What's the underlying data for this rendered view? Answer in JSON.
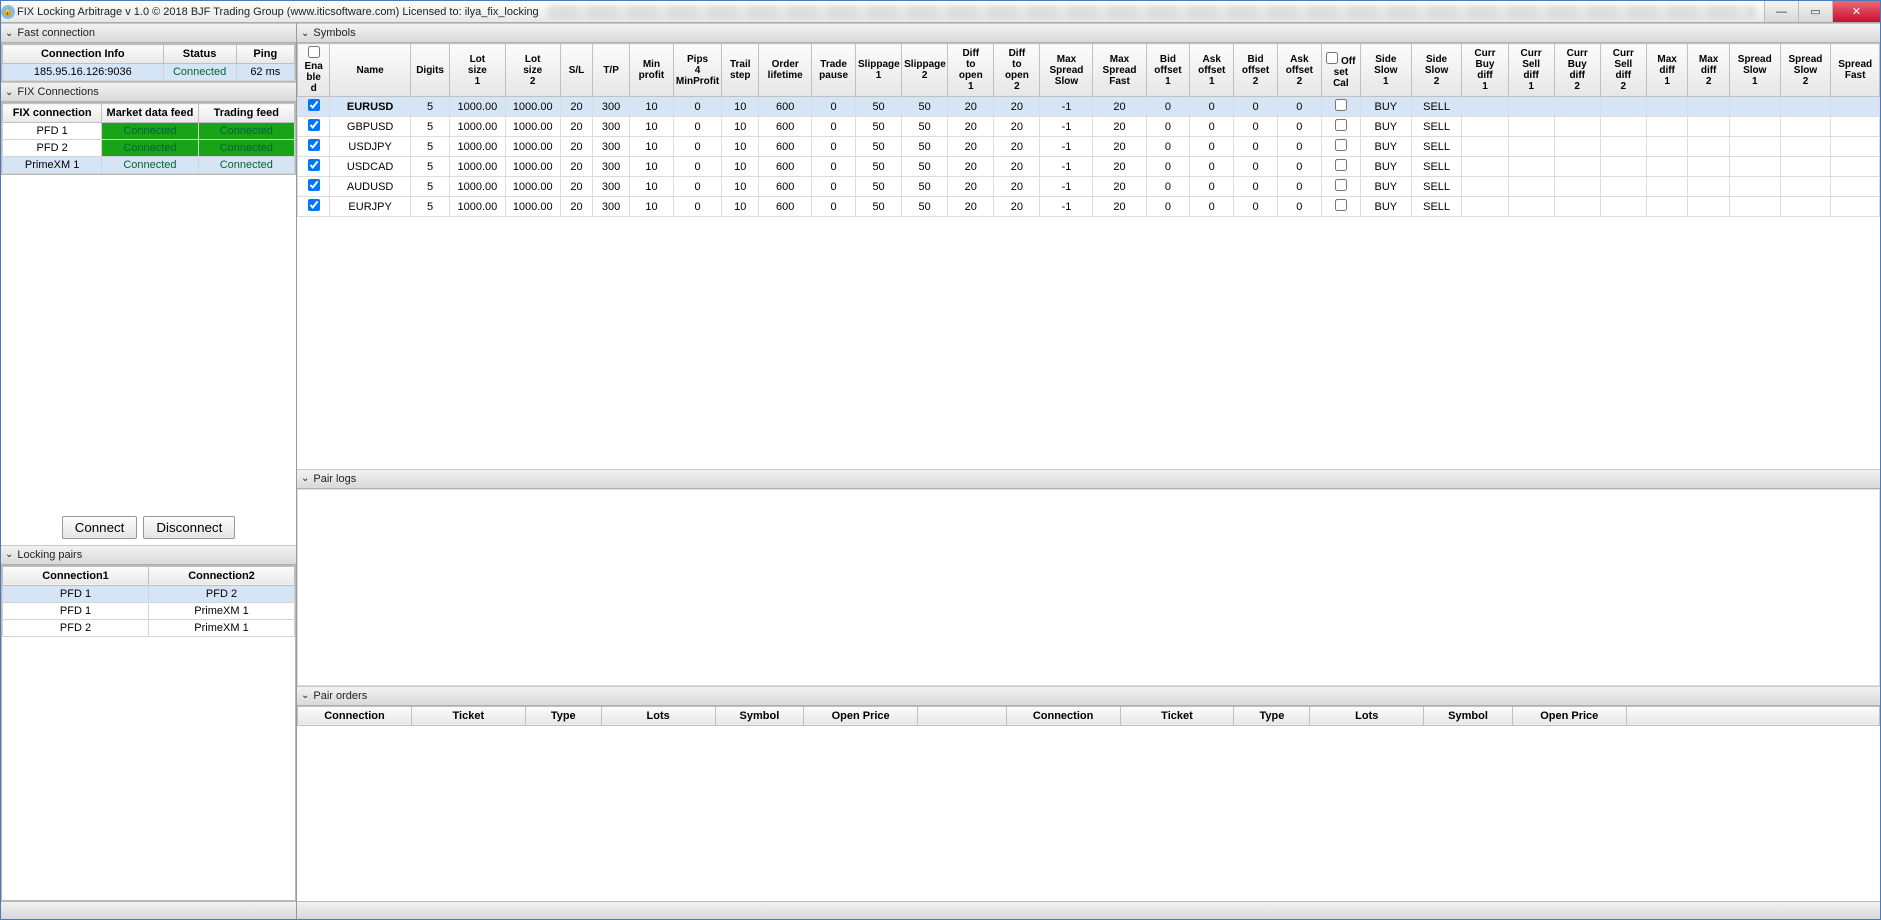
{
  "window": {
    "title": "FIX Locking Arbitrage v 1.0 © 2018 BJF Trading Group (www.iticsoftware.com) Licensed to: ilya_fix_locking"
  },
  "left": {
    "fast_connection_label": "Fast connection",
    "conn_info_headers": [
      "Connection Info",
      "Status",
      "Ping"
    ],
    "conn_info_row": {
      "addr": "185.95.16.126:9036",
      "status": "Connected",
      "ping": "62 ms"
    },
    "fix_connections_label": "FIX Connections",
    "fix_headers": [
      "FIX connection",
      "Market data feed",
      "Trading feed"
    ],
    "fix_rows": [
      {
        "name": "PFD 1",
        "market": "Connected",
        "trade": "Connected",
        "sel": false
      },
      {
        "name": "PFD 2",
        "market": "Connected",
        "trade": "Connected",
        "sel": false
      },
      {
        "name": "PrimeXM 1",
        "market": "Connected",
        "trade": "Connected",
        "sel": true
      }
    ],
    "connect_label": "Connect",
    "disconnect_label": "Disconnect",
    "locking_pairs_label": "Locking pairs",
    "lock_headers": [
      "Connection1",
      "Connection2"
    ],
    "lock_rows": [
      {
        "c1": "PFD 1",
        "c2": "PFD 2",
        "sel": true
      },
      {
        "c1": "PFD 1",
        "c2": "PrimeXM 1",
        "sel": false
      },
      {
        "c1": "PFD 2",
        "c2": "PrimeXM 1",
        "sel": false
      }
    ]
  },
  "symbols": {
    "label": "Symbols",
    "headers": [
      "Enabled",
      "Name",
      "Digits",
      "Lot size 1",
      "Lot size 2",
      "S/L",
      "T/P",
      "Min profit",
      "Pips 4 MinProfit",
      "Trail step",
      "Order lifetime",
      "Trade pause",
      "Slippage 1",
      "Slippage 2",
      "Diff to open 1",
      "Diff to open 2",
      "Max Spread Slow",
      "Max Spread Fast",
      "Bid offset 1",
      "Ask offset 1",
      "Bid offset 2",
      "Ask offset 2",
      "Offset Cal",
      "Side Slow 1",
      "Side Slow 2",
      "Curr Buy diff 1",
      "Curr Sell diff 1",
      "Curr Buy diff 2",
      "Curr Sell diff 2",
      "Max diff 1",
      "Max diff 2",
      "Spread Slow 1",
      "Spread Slow 2",
      "Spread Fast"
    ],
    "rows": [
      {
        "enabled": true,
        "sel": true,
        "name": "EURUSD",
        "digits": "5",
        "lot1": "1000.00",
        "lot2": "1000.00",
        "sl": "20",
        "tp": "300",
        "minp": "10",
        "p4mp": "0",
        "trail": "10",
        "life": "600",
        "pause": "0",
        "sl1": "50",
        "sl2": "50",
        "d1": "20",
        "d2": "20",
        "mss": "-1",
        "msf": "20",
        "bo1": "0",
        "ao1": "0",
        "bo2": "0",
        "ao2": "0",
        "oc": false,
        "side1": "BUY",
        "side2": "SELL"
      },
      {
        "enabled": true,
        "sel": false,
        "name": "GBPUSD",
        "digits": "5",
        "lot1": "1000.00",
        "lot2": "1000.00",
        "sl": "20",
        "tp": "300",
        "minp": "10",
        "p4mp": "0",
        "trail": "10",
        "life": "600",
        "pause": "0",
        "sl1": "50",
        "sl2": "50",
        "d1": "20",
        "d2": "20",
        "mss": "-1",
        "msf": "20",
        "bo1": "0",
        "ao1": "0",
        "bo2": "0",
        "ao2": "0",
        "oc": false,
        "side1": "BUY",
        "side2": "SELL"
      },
      {
        "enabled": true,
        "sel": false,
        "name": "USDJPY",
        "digits": "5",
        "lot1": "1000.00",
        "lot2": "1000.00",
        "sl": "20",
        "tp": "300",
        "minp": "10",
        "p4mp": "0",
        "trail": "10",
        "life": "600",
        "pause": "0",
        "sl1": "50",
        "sl2": "50",
        "d1": "20",
        "d2": "20",
        "mss": "-1",
        "msf": "20",
        "bo1": "0",
        "ao1": "0",
        "bo2": "0",
        "ao2": "0",
        "oc": false,
        "side1": "BUY",
        "side2": "SELL"
      },
      {
        "enabled": true,
        "sel": false,
        "name": "USDCAD",
        "digits": "5",
        "lot1": "1000.00",
        "lot2": "1000.00",
        "sl": "20",
        "tp": "300",
        "minp": "10",
        "p4mp": "0",
        "trail": "10",
        "life": "600",
        "pause": "0",
        "sl1": "50",
        "sl2": "50",
        "d1": "20",
        "d2": "20",
        "mss": "-1",
        "msf": "20",
        "bo1": "0",
        "ao1": "0",
        "bo2": "0",
        "ao2": "0",
        "oc": false,
        "side1": "BUY",
        "side2": "SELL"
      },
      {
        "enabled": true,
        "sel": false,
        "name": "AUDUSD",
        "digits": "5",
        "lot1": "1000.00",
        "lot2": "1000.00",
        "sl": "20",
        "tp": "300",
        "minp": "10",
        "p4mp": "0",
        "trail": "10",
        "life": "600",
        "pause": "0",
        "sl1": "50",
        "sl2": "50",
        "d1": "20",
        "d2": "20",
        "mss": "-1",
        "msf": "20",
        "bo1": "0",
        "ao1": "0",
        "bo2": "0",
        "ao2": "0",
        "oc": false,
        "side1": "BUY",
        "side2": "SELL"
      },
      {
        "enabled": true,
        "sel": false,
        "name": "EURJPY",
        "digits": "5",
        "lot1": "1000.00",
        "lot2": "1000.00",
        "sl": "20",
        "tp": "300",
        "minp": "10",
        "p4mp": "0",
        "trail": "10",
        "life": "600",
        "pause": "0",
        "sl1": "50",
        "sl2": "50",
        "d1": "20",
        "d2": "20",
        "mss": "-1",
        "msf": "20",
        "bo1": "0",
        "ao1": "0",
        "bo2": "0",
        "ao2": "0",
        "oc": false,
        "side1": "BUY",
        "side2": "SELL"
      }
    ]
  },
  "pair_logs_label": "Pair logs",
  "pair_orders": {
    "label": "Pair orders",
    "headers": [
      "Connection",
      "Ticket",
      "Type",
      "Lots",
      "Symbol",
      "Open Price",
      "",
      "Connection",
      "Ticket",
      "Type",
      "Lots",
      "Symbol",
      "Open Price",
      ""
    ]
  }
}
